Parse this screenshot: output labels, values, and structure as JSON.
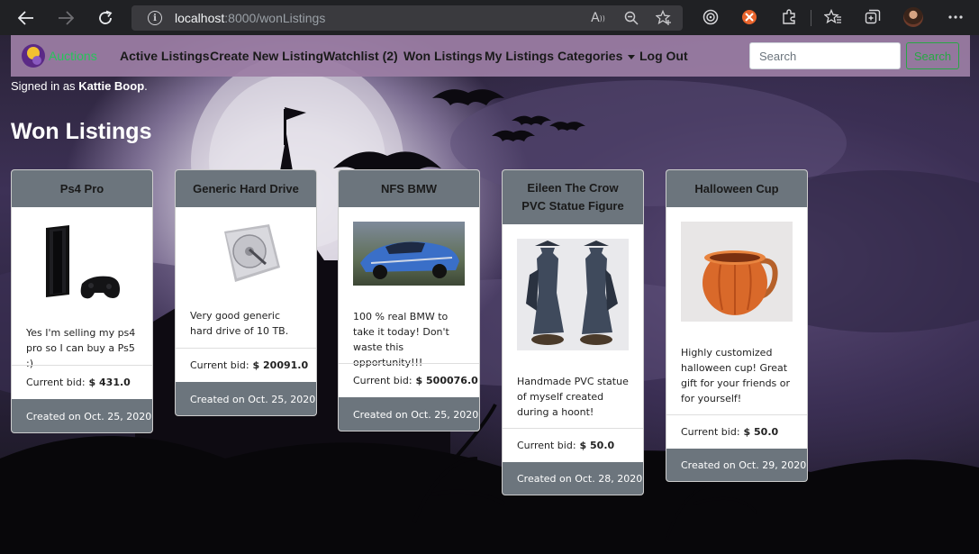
{
  "browser": {
    "url_host": "localhost",
    "url_rest": ":8000/wonListings"
  },
  "navbar": {
    "brand": "Auctions",
    "links": [
      "Active Listings",
      "Create New Listing",
      "Watchlist (2)",
      "Won Listings",
      "My Listings",
      "Categories",
      "Log Out"
    ],
    "search_placeholder": "Search",
    "search_button": "Search"
  },
  "user": {
    "prefix": "Signed in as",
    "name": "Kattie Boop",
    "suffix": "."
  },
  "page_title": "Won Listings",
  "cards": [
    {
      "title": "Ps4 Pro",
      "description": "Yes I'm selling my ps4 pro so I can buy a Ps5 :)",
      "bid_label": "Current bid:",
      "bid_value": "$ 431.0",
      "created": "Created on Oct. 25, 2020"
    },
    {
      "title": "Generic Hard Drive",
      "description": "Very good generic hard drive of 10 TB.",
      "bid_label": "Current bid:",
      "bid_value": "$ 20091.0",
      "created": "Created on Oct. 25, 2020"
    },
    {
      "title": "NFS BMW",
      "description": "100 % real BMW to take it today! Don't waste this opportunity!!!",
      "bid_label": "Current bid:",
      "bid_value": "$ 500076.0",
      "created": "Created on Oct. 25, 2020"
    },
    {
      "title": "Eileen The Crow PVC Statue Figure",
      "description": "Handmade PVC statue of myself created during a hoont!",
      "bid_label": "Current bid:",
      "bid_value": "$ 50.0",
      "created": "Created on Oct. 28, 2020"
    },
    {
      "title": "Halloween Cup",
      "description": "Highly customized halloween cup! Great gift for your friends or for yourself!",
      "bid_label": "Current bid:",
      "bid_value": "$ 50.0",
      "created": "Created on Oct. 29, 2020"
    }
  ]
}
